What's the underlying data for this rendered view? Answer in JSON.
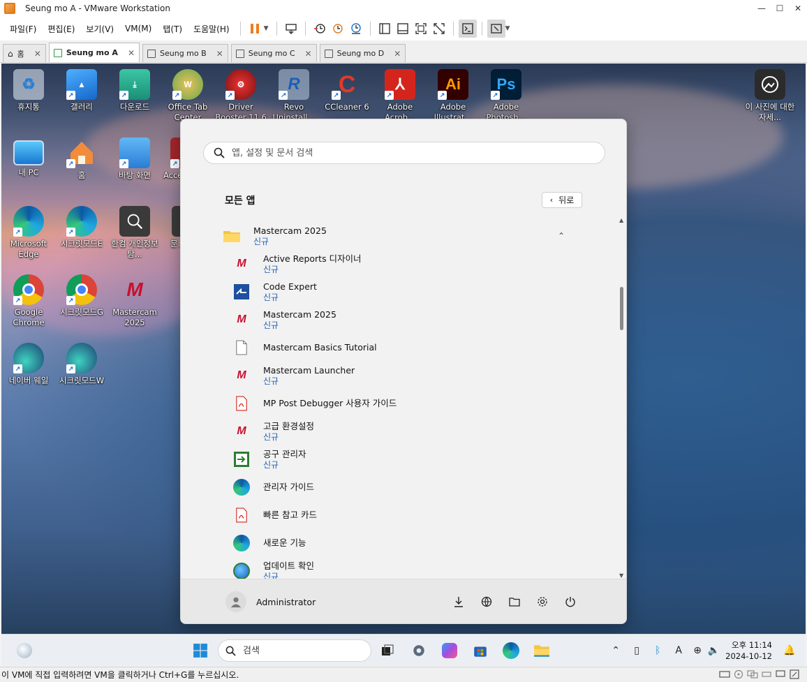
{
  "window": {
    "title": "Seung mo A - VMware Workstation",
    "controls": [
      "—",
      "☐",
      "✕"
    ]
  },
  "menu": [
    "파일(F)",
    "편집(E)",
    "보기(V)",
    "VM(M)",
    "탭(T)",
    "도움말(H)"
  ],
  "tabs": [
    {
      "label": "홈",
      "active": false
    },
    {
      "label": "Seung mo A",
      "active": true
    },
    {
      "label": "Seung mo B",
      "active": false
    },
    {
      "label": "Seung mo C",
      "active": false
    },
    {
      "label": "Seung mo D",
      "active": false
    }
  ],
  "desktop_icons": [
    {
      "label": "휴지통",
      "icon": "recycle-bin-icon"
    },
    {
      "label": "갤러리",
      "icon": "gallery-icon"
    },
    {
      "label": "다운로드",
      "icon": "downloads-folder-icon"
    },
    {
      "label": "Office Tab Center",
      "icon": "office-tab-icon"
    },
    {
      "label": "Driver Booster 11.6",
      "icon": "driver-booster-icon"
    },
    {
      "label": "Revo Uninstall...",
      "icon": "revo-uninstaller-icon"
    },
    {
      "label": "CCleaner 6",
      "icon": "ccleaner-icon"
    },
    {
      "label": "Adobe Acrob...",
      "icon": "adobe-acrobat-icon"
    },
    {
      "label": "Adobe Illustrat...",
      "icon": "adobe-illustrator-icon"
    },
    {
      "label": "Adobe Photosh...",
      "icon": "adobe-photoshop-icon"
    },
    {
      "label": "이 사진에 대한 자세...",
      "icon": "photo-info-icon"
    },
    {
      "label": "내 PC",
      "icon": "this-pc-icon"
    },
    {
      "label": "홈",
      "icon": "home-icon"
    },
    {
      "label": "바탕 화면",
      "icon": "desktop-folder-icon"
    },
    {
      "label": "Acce...",
      "icon": "access-icon"
    },
    {
      "label": "Microsoft Edge",
      "icon": "edge-icon"
    },
    {
      "label": "시크릿모드E",
      "icon": "edge-private-icon"
    },
    {
      "label": "한컴 개인정보탐...",
      "icon": "hancom-privacy-icon"
    },
    {
      "label": "문...",
      "icon": "document-icon"
    },
    {
      "label": "Google Chrome",
      "icon": "chrome-icon"
    },
    {
      "label": "시크릿모드G",
      "icon": "chrome-private-icon"
    },
    {
      "label": "Mastercam 2025",
      "icon": "mastercam-icon"
    },
    {
      "label": "네이버 웨일",
      "icon": "naver-whale-icon"
    },
    {
      "label": "시크릿모드W",
      "icon": "whale-private-icon"
    }
  ],
  "start_menu": {
    "search_placeholder": "앱, 설정 및 문서 검색",
    "all_apps_title": "모든 앱",
    "back_label": "뒤로",
    "folder": {
      "name": "Mastercam 2025",
      "badge": "신규"
    },
    "apps": [
      {
        "name": "Active Reports 디자이너",
        "badge": "신규",
        "icon": "mastercam-red-icon"
      },
      {
        "name": "Code Expert",
        "badge": "신규",
        "icon": "code-expert-icon"
      },
      {
        "name": "Mastercam 2025",
        "badge": "신규",
        "icon": "mastercam-2025-icon"
      },
      {
        "name": "Mastercam Basics Tutorial",
        "badge": "",
        "icon": "blank-document-icon"
      },
      {
        "name": "Mastercam Launcher",
        "badge": "신규",
        "icon": "mastercam-2025-icon"
      },
      {
        "name": "MP Post Debugger 사용자 가이드",
        "badge": "",
        "icon": "pdf-icon"
      },
      {
        "name": "고급 환경설정",
        "badge": "신규",
        "icon": "mastercam-settings-icon"
      },
      {
        "name": "공구 관리자",
        "badge": "신규",
        "icon": "tool-manager-icon"
      },
      {
        "name": "관리자 가이드",
        "badge": "",
        "icon": "edge-icon"
      },
      {
        "name": "빠른 참고 카드",
        "badge": "",
        "icon": "pdf-icon"
      },
      {
        "name": "새로운 기능",
        "badge": "",
        "icon": "edge-icon"
      },
      {
        "name": "업데이트 확인",
        "badge": "신규",
        "icon": "update-globe-icon"
      }
    ],
    "user": "Administrator"
  },
  "taskbar": {
    "search_placeholder": "검색",
    "time": "오후 11:14",
    "date": "2024-10-12"
  },
  "status_message": "이 VM에 직접 입력하려면 VM을 클릭하거나 Ctrl+G를 누르십시오.",
  "colors": {
    "accent": "#1f5fb5",
    "vmware_orange": "#e07a1f",
    "pause_orange": "#f07c1c"
  }
}
